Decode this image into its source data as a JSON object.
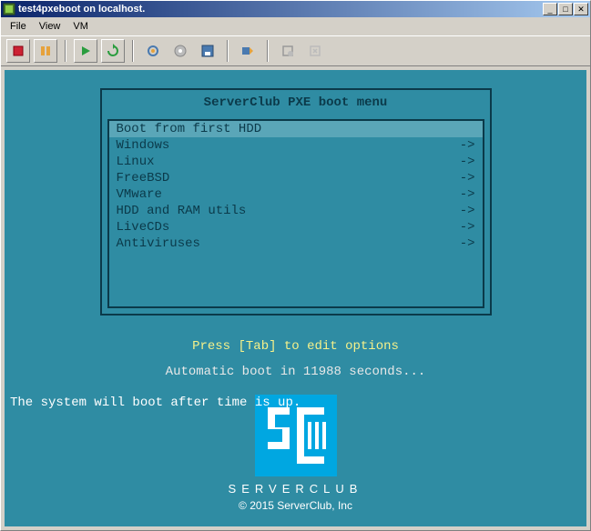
{
  "window": {
    "title": "test4pxeboot on localhost."
  },
  "menu": {
    "file": "File",
    "view": "View",
    "vm": "VM"
  },
  "toolbar": {
    "stop": "stop",
    "pause": "pause",
    "play": "play",
    "refresh": "refresh"
  },
  "pxe": {
    "title": "ServerClub PXE boot menu",
    "selected_index": 0,
    "items": [
      {
        "label": "Boot from first HDD",
        "arrow": ""
      },
      {
        "label": "Windows",
        "arrow": "->"
      },
      {
        "label": "Linux",
        "arrow": "->"
      },
      {
        "label": "FreeBSD",
        "arrow": "->"
      },
      {
        "label": "VMware",
        "arrow": "->"
      },
      {
        "label": "HDD and RAM utils",
        "arrow": "->"
      },
      {
        "label": "LiveCDs",
        "arrow": "->"
      },
      {
        "label": "Antiviruses",
        "arrow": "->"
      }
    ],
    "hint": "Press [Tab] to edit options",
    "auto": "Automatic boot in 11988 seconds...",
    "sys": "The system will boot after time is up."
  },
  "brand": {
    "name": "SERVERCLUB",
    "copy": "© 2015 ServerClub, Inc"
  }
}
